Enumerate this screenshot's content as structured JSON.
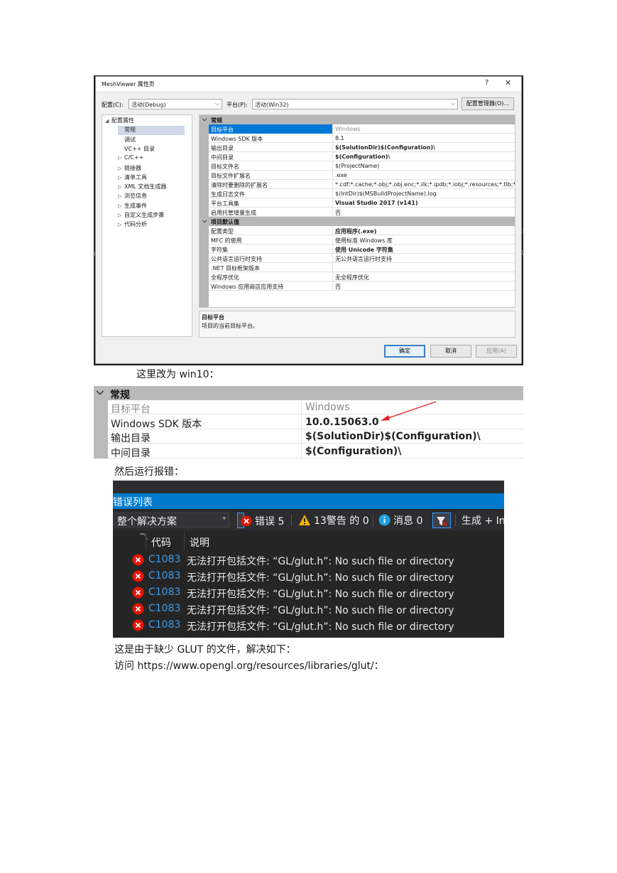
{
  "dialog": {
    "title": "MeshViewer 属性页",
    "help_glyph": "?",
    "close_glyph": "✕",
    "config_label": "配置(C):",
    "config_value": "活动(Debug)",
    "platform_label": "平台(P):",
    "platform_value": "活动(Win32)",
    "config_manager_label": "配置管理器(O)...",
    "tree": [
      {
        "label": "配置属性",
        "expander": "◢",
        "indent": 0
      },
      {
        "label": "常规",
        "expander": "",
        "indent": 1,
        "selected": true
      },
      {
        "label": "调试",
        "expander": "",
        "indent": 1
      },
      {
        "label": "VC++ 目录",
        "expander": "",
        "indent": 1
      },
      {
        "label": "C/C++",
        "expander": "▷",
        "indent": 1
      },
      {
        "label": "链接器",
        "expander": "▷",
        "indent": 1
      },
      {
        "label": "清单工具",
        "expander": "▷",
        "indent": 1
      },
      {
        "label": "XML 文档生成器",
        "expander": "▷",
        "indent": 1
      },
      {
        "label": "浏览信息",
        "expander": "▷",
        "indent": 1
      },
      {
        "label": "生成事件",
        "expander": "▷",
        "indent": 1
      },
      {
        "label": "自定义生成步骤",
        "expander": "▷",
        "indent": 1
      },
      {
        "label": "代码分析",
        "expander": "▷",
        "indent": 1
      }
    ],
    "sections": [
      {
        "title": "常规",
        "rows": [
          {
            "name": "目标平台",
            "value": "Windows",
            "style": "grey",
            "selected": true
          },
          {
            "name": "Windows SDK 版本",
            "value": "8.1",
            "style": ""
          },
          {
            "name": "输出目录",
            "value": "$(SolutionDir)$(Configuration)\\",
            "style": "bold"
          },
          {
            "name": "中间目录",
            "value": "$(Configuration)\\",
            "style": "bold"
          },
          {
            "name": "目标文件名",
            "value": "$(ProjectName)",
            "style": ""
          },
          {
            "name": "目标文件扩展名",
            "value": ".exe",
            "style": ""
          },
          {
            "name": "清除时要删除的扩展名",
            "value": "*.cdf;*.cache;*.obj;*.obj.enc;*.ilk;*.ipdb;*.iobj;*.resources;*.tlb;*.tli;*.t",
            "style": ""
          },
          {
            "name": "生成日志文件",
            "value": "$(IntDir)$(MSBuildProjectName).log",
            "style": ""
          },
          {
            "name": "平台工具集",
            "value": "Visual Studio 2017 (v141)",
            "style": "bold"
          },
          {
            "name": "启用托管增量生成",
            "value": "否",
            "style": ""
          }
        ]
      },
      {
        "title": "项目默认值",
        "rows": [
          {
            "name": "配置类型",
            "value": "应用程序(.exe)",
            "style": "bold"
          },
          {
            "name": "MFC 的使用",
            "value": "使用标准 Windows 库",
            "style": ""
          },
          {
            "name": "字符集",
            "value": "使用 Unicode 字符集",
            "style": "bold"
          },
          {
            "name": "公共语言运行时支持",
            "value": "无公共语言运行时支持",
            "style": ""
          },
          {
            "name": ".NET 目标框架版本",
            "value": "",
            "style": ""
          },
          {
            "name": "全程序优化",
            "value": "无全程序优化",
            "style": ""
          },
          {
            "name": "Windows 应用商店应用支持",
            "value": "否",
            "style": ""
          }
        ]
      }
    ],
    "description_title": "目标平台",
    "description_text": "项目的当前目标平台。",
    "ok_label": "确定",
    "cancel_label": "取消",
    "apply_label": "应用(A)",
    "stray_left": "观",
    "stray_right": "c",
    "stray_right2": "g"
  },
  "caption1": "这里改为 win10：",
  "zoom": {
    "section_title": "常规",
    "rows": [
      {
        "name": "目标平台",
        "value": "Windows",
        "style": "grey"
      },
      {
        "name": "Windows SDK 版本",
        "value": "10.0.15063.0",
        "style": "bold"
      },
      {
        "name": "输出目录",
        "value": "$(SolutionDir)$(Configuration)\\",
        "style": "bold"
      },
      {
        "name": "中间目录",
        "value": "$(Configuration)\\",
        "style": "bold"
      }
    ],
    "arrow_color": "#e02020"
  },
  "caption2": "然后运行报错：",
  "error_list": {
    "title": "错误列表",
    "scope_value": "整个解决方案",
    "errors_label": "错误 5",
    "warnings_label": "13警告 的 0",
    "messages_label": "消息 0",
    "build_label": "生成 + In",
    "col_code": "代码",
    "col_desc": "说明",
    "rows": [
      {
        "code": "C1083",
        "message": "无法打开包括文件: “GL/glut.h”: No such file or directory"
      },
      {
        "code": "C1083",
        "message": "无法打开包括文件: “GL/glut.h”: No such file or directory"
      },
      {
        "code": "C1083",
        "message": "无法打开包括文件: “GL/glut.h”: No such file or directory"
      },
      {
        "code": "C1083",
        "message": "无法打开包括文件: “GL/glut.h”: No such file or directory"
      },
      {
        "code": "C1083",
        "message": "无法打开包括文件: “GL/glut.h”: No such file or directory"
      }
    ],
    "colors": {
      "accent": "#007acc",
      "error": "#e51400",
      "warning": "#f5b400",
      "info": "#1ba1e2",
      "code_link": "#3e9ce8"
    }
  },
  "caption3": "这是由于缺少 GLUT 的文件，解决如下：",
  "caption4": "访问 https://www.opengl.org/resources/libraries/glut/："
}
